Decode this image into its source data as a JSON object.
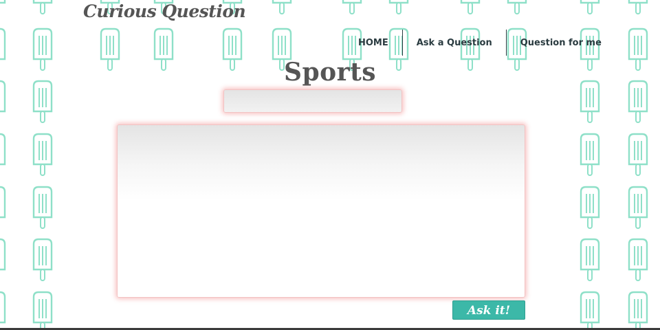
{
  "header": {
    "logo_text": "Curious Question"
  },
  "nav": {
    "items": [
      {
        "label": "HOME"
      },
      {
        "label": "Ask a Question"
      },
      {
        "label": "Question for me"
      }
    ]
  },
  "main": {
    "title": "Sports",
    "subject_input": {
      "value": "",
      "placeholder": ""
    },
    "question_textarea": {
      "value": "",
      "placeholder": ""
    },
    "submit_label": "Ask it!"
  },
  "theme": {
    "accent": "#3cb8a8",
    "pattern_color": "#8ee0c8",
    "text_dark": "#2a3b40",
    "title_gray": "#555555",
    "glow": "#f07878"
  },
  "decor": {
    "pattern_icon": "popsicle-icon"
  }
}
